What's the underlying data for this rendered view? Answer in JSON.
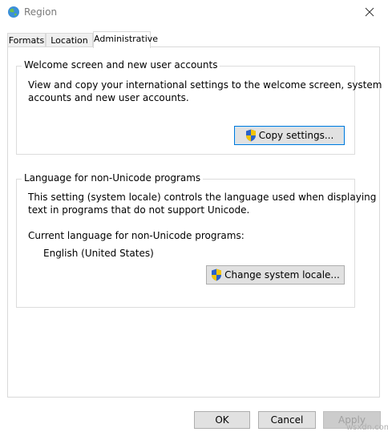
{
  "window": {
    "title": "Region"
  },
  "tabs": [
    {
      "label": "Formats"
    },
    {
      "label": "Location"
    },
    {
      "label": "Administrative",
      "active": true
    }
  ],
  "welcome_group": {
    "legend": "Welcome screen and new user accounts",
    "description_line1": "View and copy your international settings to the welcome screen, system",
    "description_line2": "accounts and new user accounts.",
    "copy_button_label": "Copy settings..."
  },
  "language_group": {
    "legend": "Language for non-Unicode programs",
    "description_line1": "This setting (system locale) controls the language used when displaying",
    "description_line2": "text in programs that do not support Unicode.",
    "current_label": "Current language for non-Unicode programs:",
    "current_value": "English (United States)",
    "change_button_label": "Change system locale..."
  },
  "footer": {
    "ok_label": "OK",
    "cancel_label": "Cancel",
    "apply_label": "Apply"
  },
  "watermark": "wsxdn.com",
  "colors": {
    "accent": "#0078d7",
    "button_face": "#e1e1e1",
    "title_text": "#7a7a7a"
  },
  "icons": [
    "globe-icon",
    "close-icon",
    "uac-shield-icon"
  ]
}
